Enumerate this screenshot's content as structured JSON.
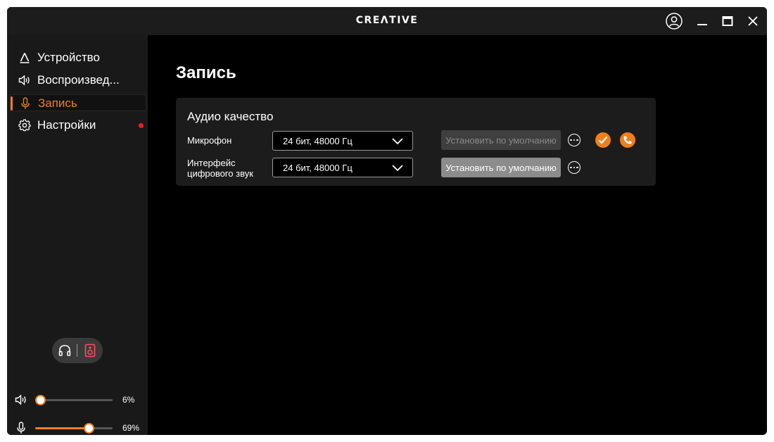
{
  "titlebar": {
    "logo": "CREΛTIVE",
    "icons": [
      "user-profile-icon",
      "minimize-icon",
      "maximize-icon",
      "close-icon"
    ]
  },
  "sidebar": {
    "items": [
      {
        "label": "Устройство",
        "icon": "device-icon",
        "active": false
      },
      {
        "label": "Воспроизвед...",
        "icon": "speaker-icon",
        "active": false
      },
      {
        "label": "Запись",
        "icon": "microphone-icon",
        "active": true
      },
      {
        "label": "Настройки",
        "icon": "gear-icon",
        "active": false,
        "notification": true
      }
    ],
    "output_toggle": {
      "icons": [
        "headphones-icon",
        "speaker-box-icon"
      ],
      "selected": "speaker-box-icon"
    },
    "volume": {
      "playback_value": "6%",
      "playback_level": 6,
      "mic_value": "69%",
      "mic_level": 69
    }
  },
  "main": {
    "title": "Запись",
    "card": {
      "title": "Аудио качество",
      "rows": [
        {
          "label": "Микрофон",
          "select_value": "24 бит, 48000 Гц",
          "default_label": "Установить по умолчанию",
          "default_enabled": false
        },
        {
          "label_line1": "Интерфейс",
          "label_line2": "цифрового звук",
          "select_value": "24 бит, 48000 Гц",
          "default_label": "Установить по умолчанию",
          "default_enabled": true
        }
      ],
      "status_icons": [
        "checkmark-icon",
        "phone-call-icon"
      ]
    }
  },
  "colors": {
    "accent": "#f07f1a",
    "notification": "#ff1a1a",
    "card": "#1c1c1c",
    "sidebar": "#191919"
  }
}
